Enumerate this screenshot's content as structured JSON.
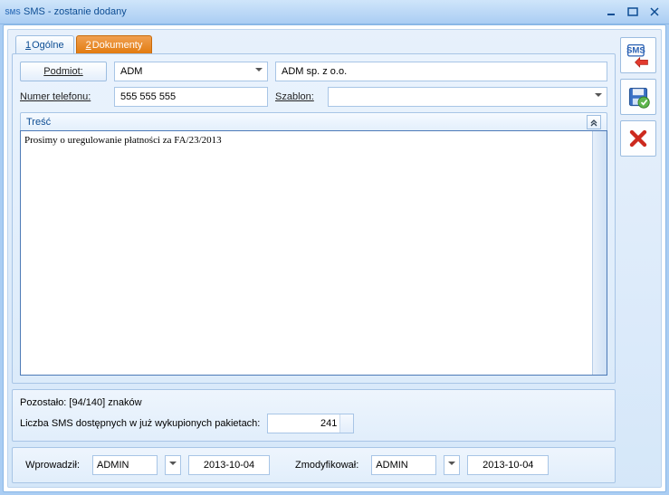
{
  "window": {
    "title": "SMS - zostanie dodany"
  },
  "tabs": {
    "general_key": "1",
    "general_label": " Ogólne",
    "documents_key": "2",
    "documents_label": " Dokumenty"
  },
  "form": {
    "podmiot_btn": "Podmiot:",
    "podmiot_value": "ADM",
    "podmiot_name": "ADM sp. z o.o.",
    "nr_label": "Numer telefonu:",
    "nr_value": "555 555 555",
    "szablon_label": "Szablon:",
    "szablon_value": "",
    "tresc_header": "Treść",
    "tresc_value": "Prosimy o uregulowanie płatności za FA/23/2013"
  },
  "stats": {
    "remaining_label": "Pozostało: [94/140] znaków",
    "available_label": "Liczba SMS dostępnych w już wykupionych pakietach:",
    "available_value": "241"
  },
  "audit": {
    "created_label": "Wprowadził:",
    "created_user": "ADMIN",
    "created_date": "2013-10-04",
    "mod_label": "Zmodyfikował:",
    "mod_user": "ADMIN",
    "mod_date": "2013-10-04"
  }
}
